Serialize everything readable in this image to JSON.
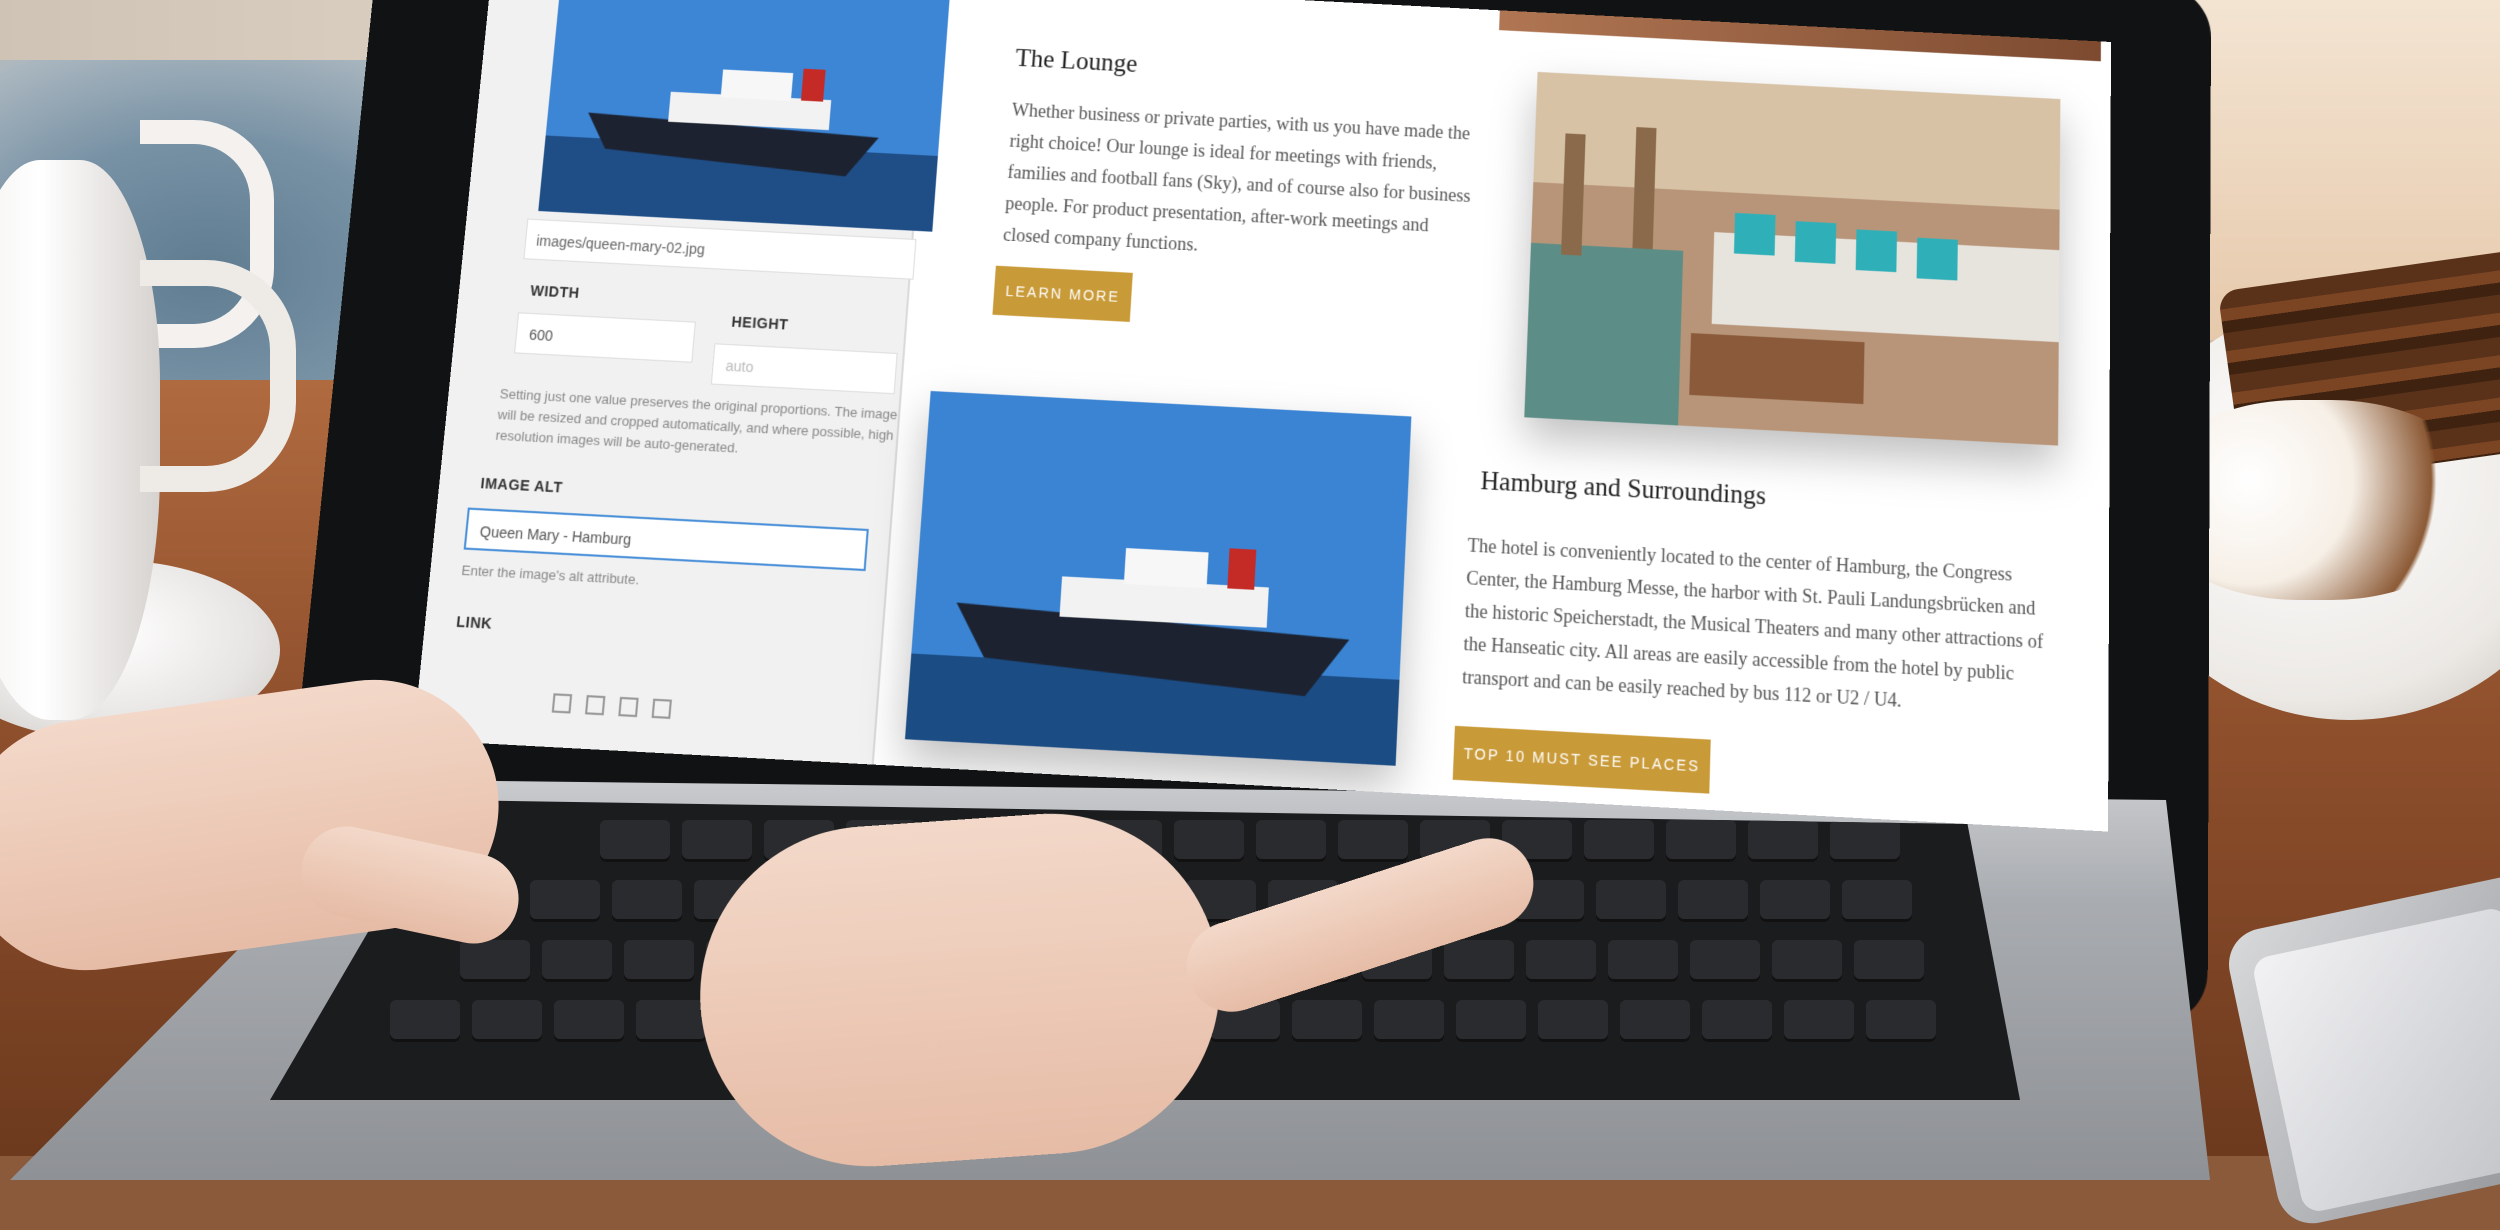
{
  "editor": {
    "image_path": "images/queen-mary-02.jpg",
    "width_label": "WIDTH",
    "width_value": "600",
    "height_label": "HEIGHT",
    "height_placeholder": "auto",
    "size_help": "Setting just one value preserves the original proportions. The image will be resized and cropped automatically, and where possible, high resolution images will be auto-generated.",
    "alt_label": "IMAGE ALT",
    "alt_value": "Queen Mary - Hamburg",
    "alt_help": "Enter the image's alt attribute.",
    "link_label": "LINK"
  },
  "lounge": {
    "title": "The Lounge",
    "text": "Whether business or private parties, with us you have made the right choice! Our lounge is ideal for meetings with friends, families and football fans (Sky), and of course also for business people. For product presentation, after-work meetings and closed company functions.",
    "button": "LEARN MORE"
  },
  "hamburg": {
    "title": "Hamburg and Surroundings",
    "text": "The hotel is conveniently located to the center of Hamburg, the Congress Center, the Hamburg Messe, the harbor with St. Pauli Landungsbrücken and the historic Speicherstadt, the Musical Theaters and many other attractions of the Hanseatic city. All areas are easily accessible from the hotel by public transport and can be easily reached by bus 112 or U2 / U4.",
    "button": "TOP 10 MUST SEE PLACES"
  },
  "colors": {
    "accent": "#c99a38",
    "focus": "#4a90d9"
  }
}
